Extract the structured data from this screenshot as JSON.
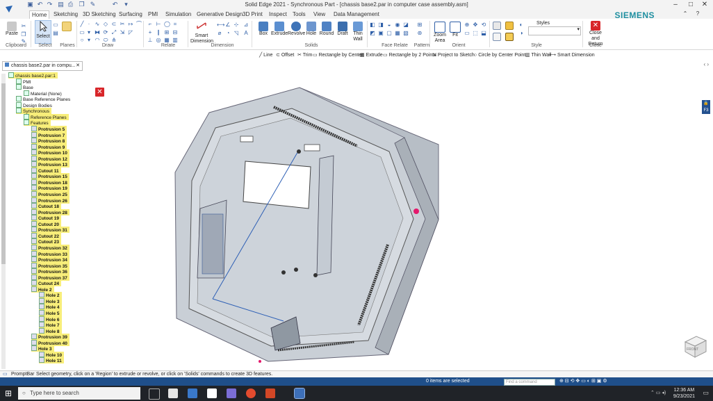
{
  "window": {
    "title": "Solid Edge 2021 - Synchronous Part - [chassis base2.par in computer case assembly.asm]",
    "brand": "SIEMENS"
  },
  "tabs": [
    "Home",
    "Sketching",
    "3D Sketching",
    "Surfacing",
    "PMI",
    "Simulation",
    "Generative Design",
    "3D Print",
    "Inspect",
    "Tools",
    "View",
    "Data Management"
  ],
  "ribbon": {
    "paste": "Paste",
    "select": "Select",
    "smart_dimension": "Smart Dimension",
    "solids": [
      "Box",
      "Extrude",
      "Revolve",
      "Hole",
      "Round",
      "Draft",
      "Thin Wall"
    ],
    "zoom_area": "Zoom Area",
    "fit": "Fit",
    "styles_label": "Styles",
    "close": "Close and Return",
    "groups": {
      "clipboard": "Clipboard",
      "select": "Select",
      "planes": "Planes",
      "draw": "Draw",
      "relate": "Relate",
      "dimension": "Dimension",
      "solids": "Solids",
      "face_relate": "Face Relate",
      "pattern": "Pattern",
      "orient": "Orient",
      "style": "Style",
      "close": "Close"
    }
  },
  "command_bar": [
    "Line",
    "Offset",
    "Trim",
    "Rectangle by Center",
    "Extrude",
    "Rectangle by 2 Points",
    "Project to Sketch",
    "Circle by Center Point",
    "Thin Wall",
    "Smart Dimension"
  ],
  "doc_tab": "chassis base2.par in compu...",
  "tree": [
    {
      "label": "chassis base2.par:1",
      "indent": 0,
      "hl": true
    },
    {
      "label": "PMI",
      "indent": 1,
      "hl": false
    },
    {
      "label": "Base",
      "indent": 1,
      "hl": false
    },
    {
      "label": "Material (None)",
      "indent": 2,
      "hl": false
    },
    {
      "label": "Base Reference Planes",
      "indent": 1,
      "hl": false
    },
    {
      "label": "Design Bodies",
      "indent": 1,
      "hl": false
    },
    {
      "label": "Synchronous",
      "indent": 1,
      "hl": true
    },
    {
      "label": "Reference Planes",
      "indent": 2,
      "hl": true
    },
    {
      "label": "Features",
      "indent": 2,
      "hl": true
    },
    {
      "label": "Protrusion 5",
      "indent": 3,
      "hl": true
    },
    {
      "label": "Protrusion 7",
      "indent": 3,
      "hl": true
    },
    {
      "label": "Protrusion 8",
      "indent": 3,
      "hl": true
    },
    {
      "label": "Protrusion 9",
      "indent": 3,
      "hl": true
    },
    {
      "label": "Protrusion 10",
      "indent": 3,
      "hl": true
    },
    {
      "label": "Protrusion 12",
      "indent": 3,
      "hl": true
    },
    {
      "label": "Protrusion 13",
      "indent": 3,
      "hl": true
    },
    {
      "label": "Cutout 11",
      "indent": 3,
      "hl": true
    },
    {
      "label": "Protrusion 15",
      "indent": 3,
      "hl": true
    },
    {
      "label": "Protrusion 18",
      "indent": 3,
      "hl": true
    },
    {
      "label": "Protrusion 19",
      "indent": 3,
      "hl": true
    },
    {
      "label": "Protrusion 25",
      "indent": 3,
      "hl": true
    },
    {
      "label": "Protrusion 26",
      "indent": 3,
      "hl": true
    },
    {
      "label": "Cutout 18",
      "indent": 3,
      "hl": true
    },
    {
      "label": "Protrusion 28",
      "indent": 3,
      "hl": true
    },
    {
      "label": "Cutout 19",
      "indent": 3,
      "hl": true
    },
    {
      "label": "Cutout 20",
      "indent": 3,
      "hl": true
    },
    {
      "label": "Protrusion 31",
      "indent": 3,
      "hl": true
    },
    {
      "label": "Cutout 22",
      "indent": 3,
      "hl": true
    },
    {
      "label": "Cutout 23",
      "indent": 3,
      "hl": true
    },
    {
      "label": "Protrusion 32",
      "indent": 3,
      "hl": true
    },
    {
      "label": "Protrusion 33",
      "indent": 3,
      "hl": true
    },
    {
      "label": "Protrusion 34",
      "indent": 3,
      "hl": true
    },
    {
      "label": "Protrusion 35",
      "indent": 3,
      "hl": true
    },
    {
      "label": "Protrusion 36",
      "indent": 3,
      "hl": true
    },
    {
      "label": "Protrusion 37",
      "indent": 3,
      "hl": true
    },
    {
      "label": "Cutout 24",
      "indent": 3,
      "hl": true
    },
    {
      "label": "Hole 2",
      "indent": 3,
      "hl": true
    },
    {
      "label": "Hole 2",
      "indent": 4,
      "hl": true
    },
    {
      "label": "Hole 3",
      "indent": 4,
      "hl": true
    },
    {
      "label": "Hole 4",
      "indent": 4,
      "hl": true
    },
    {
      "label": "Hole 5",
      "indent": 4,
      "hl": true
    },
    {
      "label": "Hole 6",
      "indent": 4,
      "hl": true
    },
    {
      "label": "Hole 7",
      "indent": 4,
      "hl": true
    },
    {
      "label": "Hole 8",
      "indent": 4,
      "hl": true
    },
    {
      "label": "Protrusion 39",
      "indent": 3,
      "hl": true
    },
    {
      "label": "Protrusion 40",
      "indent": 3,
      "hl": true
    },
    {
      "label": "Hole 3",
      "indent": 3,
      "hl": true
    },
    {
      "label": "Hole 10",
      "indent": 4,
      "hl": true
    },
    {
      "label": "Hole 11",
      "indent": 4,
      "hl": true
    }
  ],
  "view_cube_label": "FRONT",
  "lock_badge": "F3",
  "prompt": {
    "label": "PromptBar",
    "text": "Select geometry, click on a 'Region' to extrude or revolve, or click on 'Solids' commands to create 3D features."
  },
  "status": {
    "items_selected": "0 items are selected",
    "find_command": "Find a command"
  },
  "taskbar": {
    "search_placeholder": "Type here to search",
    "time": "12:36 AM",
    "date": "9/23/2021"
  },
  "colors": {
    "accent": "#1e8fa0",
    "highlight": "#f8ee7a",
    "statusbar": "#1f4f8a",
    "close_red": "#d8262a"
  }
}
